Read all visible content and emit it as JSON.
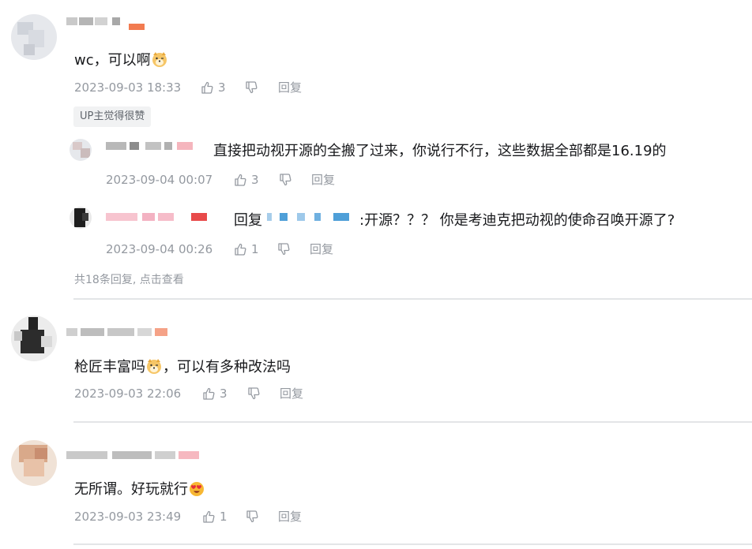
{
  "comments": [
    {
      "content_pre": "wc，可以啊",
      "emoji": "doge-emoji",
      "content_post": "",
      "time": "2023-09-03 18:33",
      "likes": "3",
      "reply_label": "回复",
      "tag": "UP主觉得很赞",
      "replies": [
        {
          "content": "直接把动视开源的全搬了过来，你说行不行，这些数据全部都是16.19的",
          "time": "2023-09-04 00:07",
          "likes": "3",
          "reply_label": "回复"
        },
        {
          "reply_prefix": "回复",
          "content": ":开源？？？ 你是考迪克把动视的使命召唤开源了?",
          "time": "2023-09-04 00:26",
          "likes": "1",
          "reply_label": "回复"
        }
      ],
      "more_replies": "共18条回复, 点击查看"
    },
    {
      "content_pre": "枪匠丰富吗",
      "emoji": "doge-emoji",
      "content_post": "，可以有多种改法吗",
      "time": "2023-09-03 22:06",
      "likes": "3",
      "reply_label": "回复"
    },
    {
      "content_pre": "无所谓。好玩就行",
      "emoji": "heart-eyes-emoji",
      "content_post": "",
      "time": "2023-09-03 23:49",
      "likes": "1",
      "reply_label": "回复"
    }
  ],
  "colors": {
    "text": "#18191c",
    "meta": "#9499a0",
    "divider": "#e3e5e7",
    "level_badge": "#f27b50",
    "tag_bg": "#f1f2f3"
  }
}
